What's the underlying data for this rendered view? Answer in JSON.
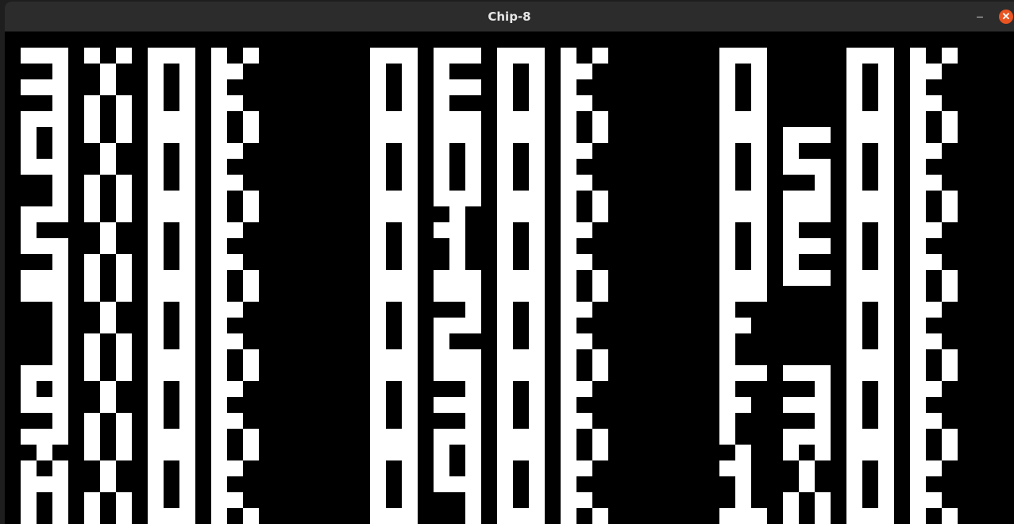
{
  "window": {
    "title": "Chip-8",
    "minimize_icon": "minimize-icon",
    "close_icon": "close-icon",
    "minimize_glyph": "–",
    "close_glyph": "✕",
    "close_color": "#e95420"
  },
  "display": {
    "foreground": "#ffffff",
    "background": "#000000",
    "columns": [
      [
        "3X",
        "4X",
        "5X",
        "7X",
        "9X",
        "AX"
      ],
      [
        "0E",
        "00",
        "01",
        "02",
        "03",
        "04"
      ],
      [
        "0 5",
        "05",
        "0E",
        "F 5",
        "F3",
        "1X"
      ]
    ],
    "status_text": "OK"
  }
}
